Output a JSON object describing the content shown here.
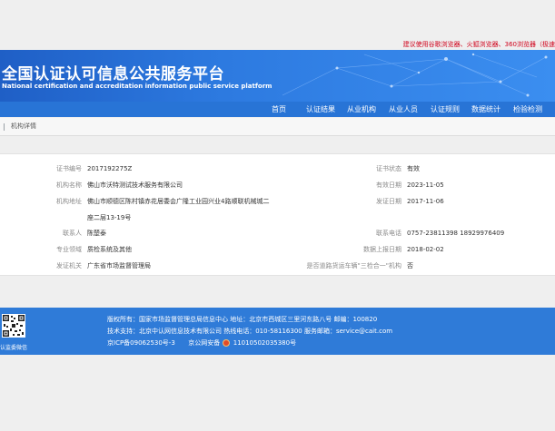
{
  "top_notice": "建议使用谷歌浏览器、火狐浏览器、360浏览器（极速",
  "header": {
    "title": "全国认证认可信息公共服务平台",
    "subtitle": "National certification and accreditation information public service platform"
  },
  "nav": [
    "首页",
    "认证结果",
    "从业机构",
    "从业人员",
    "认证规则",
    "数据统计",
    "检验检测"
  ],
  "breadcrumb": "机构详情",
  "detail": {
    "cert_no_label": "证书编号",
    "cert_no": "2017192275Z",
    "cert_status_label": "证书状态",
    "cert_status": "有效",
    "org_name_label": "机构名称",
    "org_name": "佛山市沃特测试技术服务有限公司",
    "valid_date_label": "有效日期",
    "valid_date": "2023-11-05",
    "org_addr_label": "机构地址",
    "org_addr_1": "佛山市顺德区陈村镇赤花居委会广隆工业园兴业4路顺联机械城二",
    "org_addr_2": "座二层13-19号",
    "issue_date_label": "发证日期",
    "issue_date": "2017-11-06",
    "contact_label": "联系人",
    "contact": "陈楚泰",
    "phone_label": "联系电话",
    "phone": "0757-23811398 18929976409",
    "field_label": "专业领域",
    "field": "质检系统及其他",
    "report_date_label": "数据上报日期",
    "report_date": "2018-02-02",
    "authority_label": "发证机关",
    "authority": "广东省市场监督管理局",
    "combo_label": "是否道路货运车辆\"三检合一\"机构",
    "combo": "否"
  },
  "footer": {
    "qr_caption": "认监委微信",
    "line1": "版权所有：国家市场监督管理总局信息中心    地址：北京市西城区三里河东路八号    邮编：100820",
    "line2": "技术支持：北京中认网信息技术有限公司    热线电话：010-58116300    服务邮箱：service@cait.com",
    "line3a": "京ICP备09062530号-3",
    "line3b": "京公网安备",
    "line3c": "11010502035380号"
  }
}
